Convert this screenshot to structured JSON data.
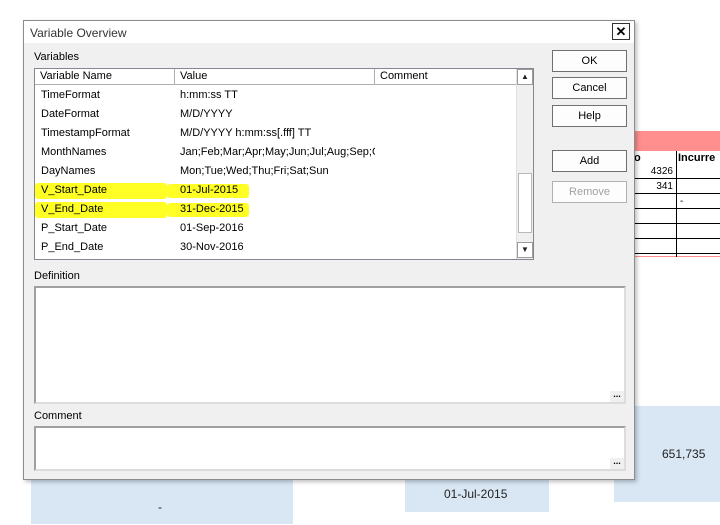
{
  "dialog": {
    "title": "Variable Overview",
    "close_glyph": "✕",
    "variables_label": "Variables",
    "definition_label": "Definition",
    "comment_label": "Comment"
  },
  "columns": {
    "name": "Variable Name",
    "value": "Value",
    "comment": "Comment"
  },
  "rows": [
    {
      "name": "TimeFormat",
      "value": "h:mm:ss TT",
      "highlighted": false
    },
    {
      "name": "DateFormat",
      "value": "M/D/YYYY",
      "highlighted": false
    },
    {
      "name": "TimestampFormat",
      "value": "M/D/YYYY h:mm:ss[.fff] TT",
      "highlighted": false
    },
    {
      "name": "MonthNames",
      "value": "Jan;Feb;Mar;Apr;May;Jun;Jul;Aug;Sep;Oct;Nov;Dec",
      "highlighted": false
    },
    {
      "name": "DayNames",
      "value": "Mon;Tue;Wed;Thu;Fri;Sat;Sun",
      "highlighted": false
    },
    {
      "name": "V_Start_Date",
      "value": "01-Jul-2015",
      "highlighted": true
    },
    {
      "name": "V_End_Date",
      "value": "31-Dec-2015",
      "highlighted": true
    },
    {
      "name": "P_Start_Date",
      "value": "01-Sep-2016",
      "highlighted": false
    },
    {
      "name": "P_End_Date",
      "value": "30-Nov-2016",
      "highlighted": false
    }
  ],
  "buttons": {
    "ok": "OK",
    "cancel": "Cancel",
    "help": "Help",
    "add": "Add",
    "remove": "Remove"
  },
  "textboxes": {
    "definition_value": "",
    "comment_value": "",
    "ellipsis": "..."
  },
  "scrollbar": {
    "up_glyph": "▲",
    "down_glyph": "▼"
  },
  "background": {
    "col_header_1": "o",
    "col_header_2": "Incurre",
    "cells": [
      "4326",
      "341",
      "-"
    ],
    "panel_value_right": "651,735",
    "panel_value_center": "01-Jul-2015",
    "panel_value_left": "-"
  },
  "colors": {
    "highlight": "#ffff00",
    "sheet_header_red": "#ff8f8f",
    "sheet_panel_blue": "#d9e7f5"
  }
}
